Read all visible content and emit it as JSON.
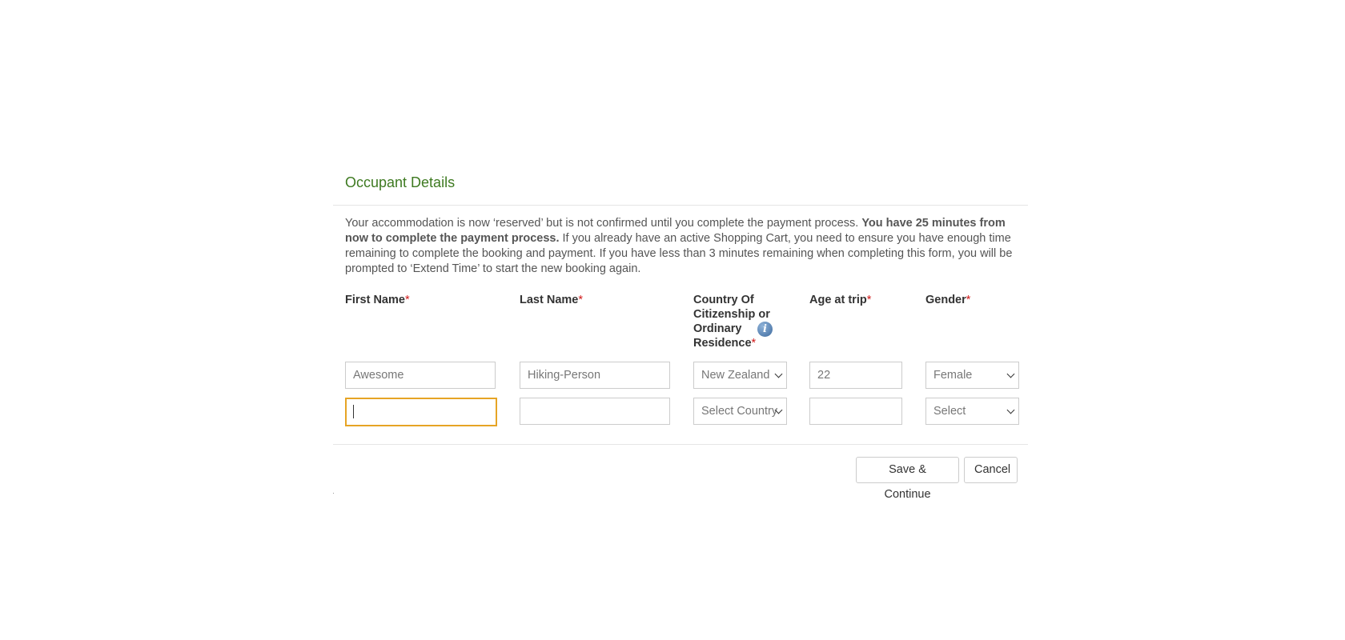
{
  "modal": {
    "title": "Occupant Details",
    "notice": {
      "part1": "Your accommodation is now ‘reserved’ but is not confirmed until you complete the payment process. ",
      "bold": "You have 25 minutes from now to complete the payment process.",
      "part2": " If you already have an active Shopping Cart, you need to ensure you have enough time remaining to complete the booking and payment. If you have less than 3 minutes remaining when completing this form, you will be prompted to ‘Extend Time’ to start the new booking again."
    },
    "columns": {
      "first_name": "First Name",
      "last_name": "Last Name",
      "country_l1": "Country Of",
      "country_l2": "Citizenship or",
      "country_l3": "Ordinary",
      "country_l4": "Residence",
      "age": "Age at trip",
      "gender": "Gender",
      "required_mark": "*",
      "info_icon": "i"
    },
    "rows": [
      {
        "first_name": "Awesome",
        "last_name": "Hiking-Person",
        "country": "New Zealand",
        "age": "22",
        "gender": "Female"
      },
      {
        "first_name": "",
        "last_name": "",
        "country": "Select Country",
        "age": "",
        "gender": "Select"
      }
    ],
    "buttons": {
      "save": "Save & Continue",
      "cancel": "Cancel"
    }
  },
  "icons": {
    "info": "info-icon",
    "dropdown": "chevron-down-icon"
  },
  "colors": {
    "title": "#3e7a21",
    "required": "#d01818",
    "focus": "#e6a425"
  }
}
